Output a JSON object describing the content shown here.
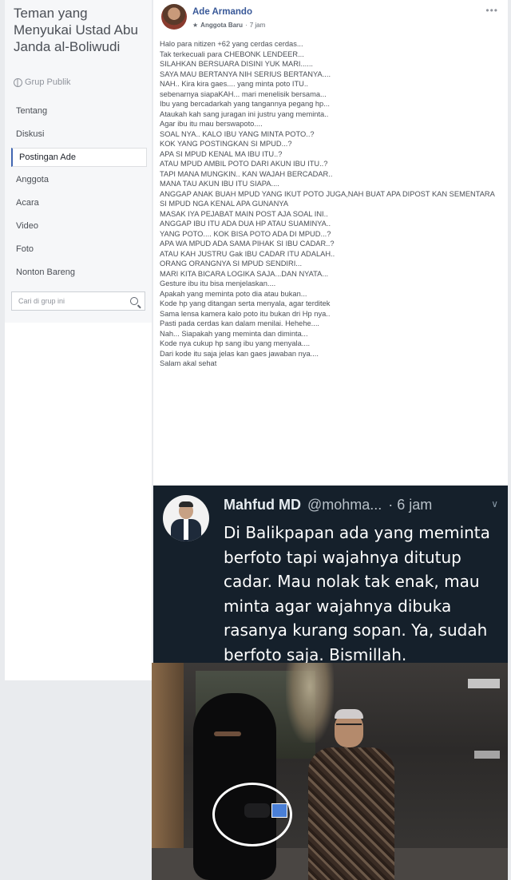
{
  "group": {
    "title": "Teman yang Menyukai Ustad Abu Janda al-Boliwudi",
    "type": "Grup Publik"
  },
  "nav": [
    {
      "label": "Tentang",
      "active": false
    },
    {
      "label": "Diskusi",
      "active": false
    },
    {
      "label": "Postingan Ade",
      "active": true
    },
    {
      "label": "Anggota",
      "active": false
    },
    {
      "label": "Acara",
      "active": false
    },
    {
      "label": "Video",
      "active": false
    },
    {
      "label": "Foto",
      "active": false
    },
    {
      "label": "Nonton Bareng",
      "active": false
    }
  ],
  "search": {
    "placeholder": "Cari di grup ini"
  },
  "post": {
    "author": "Ade Armando",
    "badge": "Anggota Baru",
    "time": "7 jam",
    "lines": [
      "Halo para nitizen +62 yang cerdas cerdas...",
      "Tak terkecuali para CHEBONK LENDEER...",
      "SILAHKAN BERSUARA DISINI YUK MARI......",
      "SAYA MAU BERTANYA NIH SERIUS BERTANYA....",
      "NAH.. Kira kira gaes.... yang minta poto ITU..",
      "sebenarnya siapaKAH... mari menelisik bersama...",
      "Ibu yang bercadarkah yang tangannya pegang hp...",
      "Ataukah kah sang juragan ini justru yang meminta..",
      "Agar ibu itu mau berswapoto....",
      "SOAL NYA.. KALO IBU YANG MINTA POTO..?",
      "KOK YANG POSTINGKAN SI MPUD...?",
      "APA SI MPUD KENAL MA IBU ITU..?",
      "ATAU MPUD AMBIL POTO DARI AKUN IBU ITU..?",
      "TAPI MANA MUNGKIN.. KAN WAJAH BERCADAR..",
      "MANA TAU AKUN IBU ITU SIAPA....",
      "ANGGAP ANAK BUAH MPUD YANG IKUT POTO JUGA,NAH BUAT APA DIPOST KAN SEMENTARA",
      "SI MPUD NGA KENAL APA GUNANYA",
      "MASAK IYA PEJABAT MAIN POST AJA SOAL INI..",
      "ANGGAP IBU ITU ADA DUA HP ATAU SUAMINYA..",
      "YANG POTO.... KOK BISA POTO ADA DI MPUD...?",
      "APA WA MPUD ADA SAMA PIHAK SI IBU CADAR..?",
      "ATAU KAH JUSTRU Gak IBU CADAR ITU ADALAH..",
      "ORANG ORANGNYA SI MPUD SENDIRI...",
      "MARI KITA BICARA LOGIKA SAJA...DAN NYATA...",
      "Gesture ibu itu bisa menjelaskan....",
      "Apakah yang meminta poto dia atau bukan...",
      "Kode hp yang ditangan serta menyala, agar terditek",
      "Sama lensa kamera kalo poto itu bukan dri Hp nya..",
      "Pasti pada cerdas kan dalam menilai. Hehehe....",
      "Nah... Siapakah yang meminta dan diminta...",
      "Kode nya cukup hp sang ibu yang menyala....",
      "Dari kode itu saja jelas kan gaes jawaban nya....",
      "Salam akal sehat"
    ]
  },
  "tweet": {
    "name": "Mahfud MD",
    "handle": "@mohma...",
    "time": "· 6 jam",
    "text": "Di Balikpapan ada yang meminta berfoto tapi wajahnya ditutup cadar. Mau nolak tak enak, mau minta agar wajahnya dibuka rasanya kurang sopan. Ya, sudah berfoto saja. Bismillah."
  },
  "colors": {
    "link": "#385898",
    "accent": "#4267b2",
    "tweet_bg": "#15202b"
  }
}
